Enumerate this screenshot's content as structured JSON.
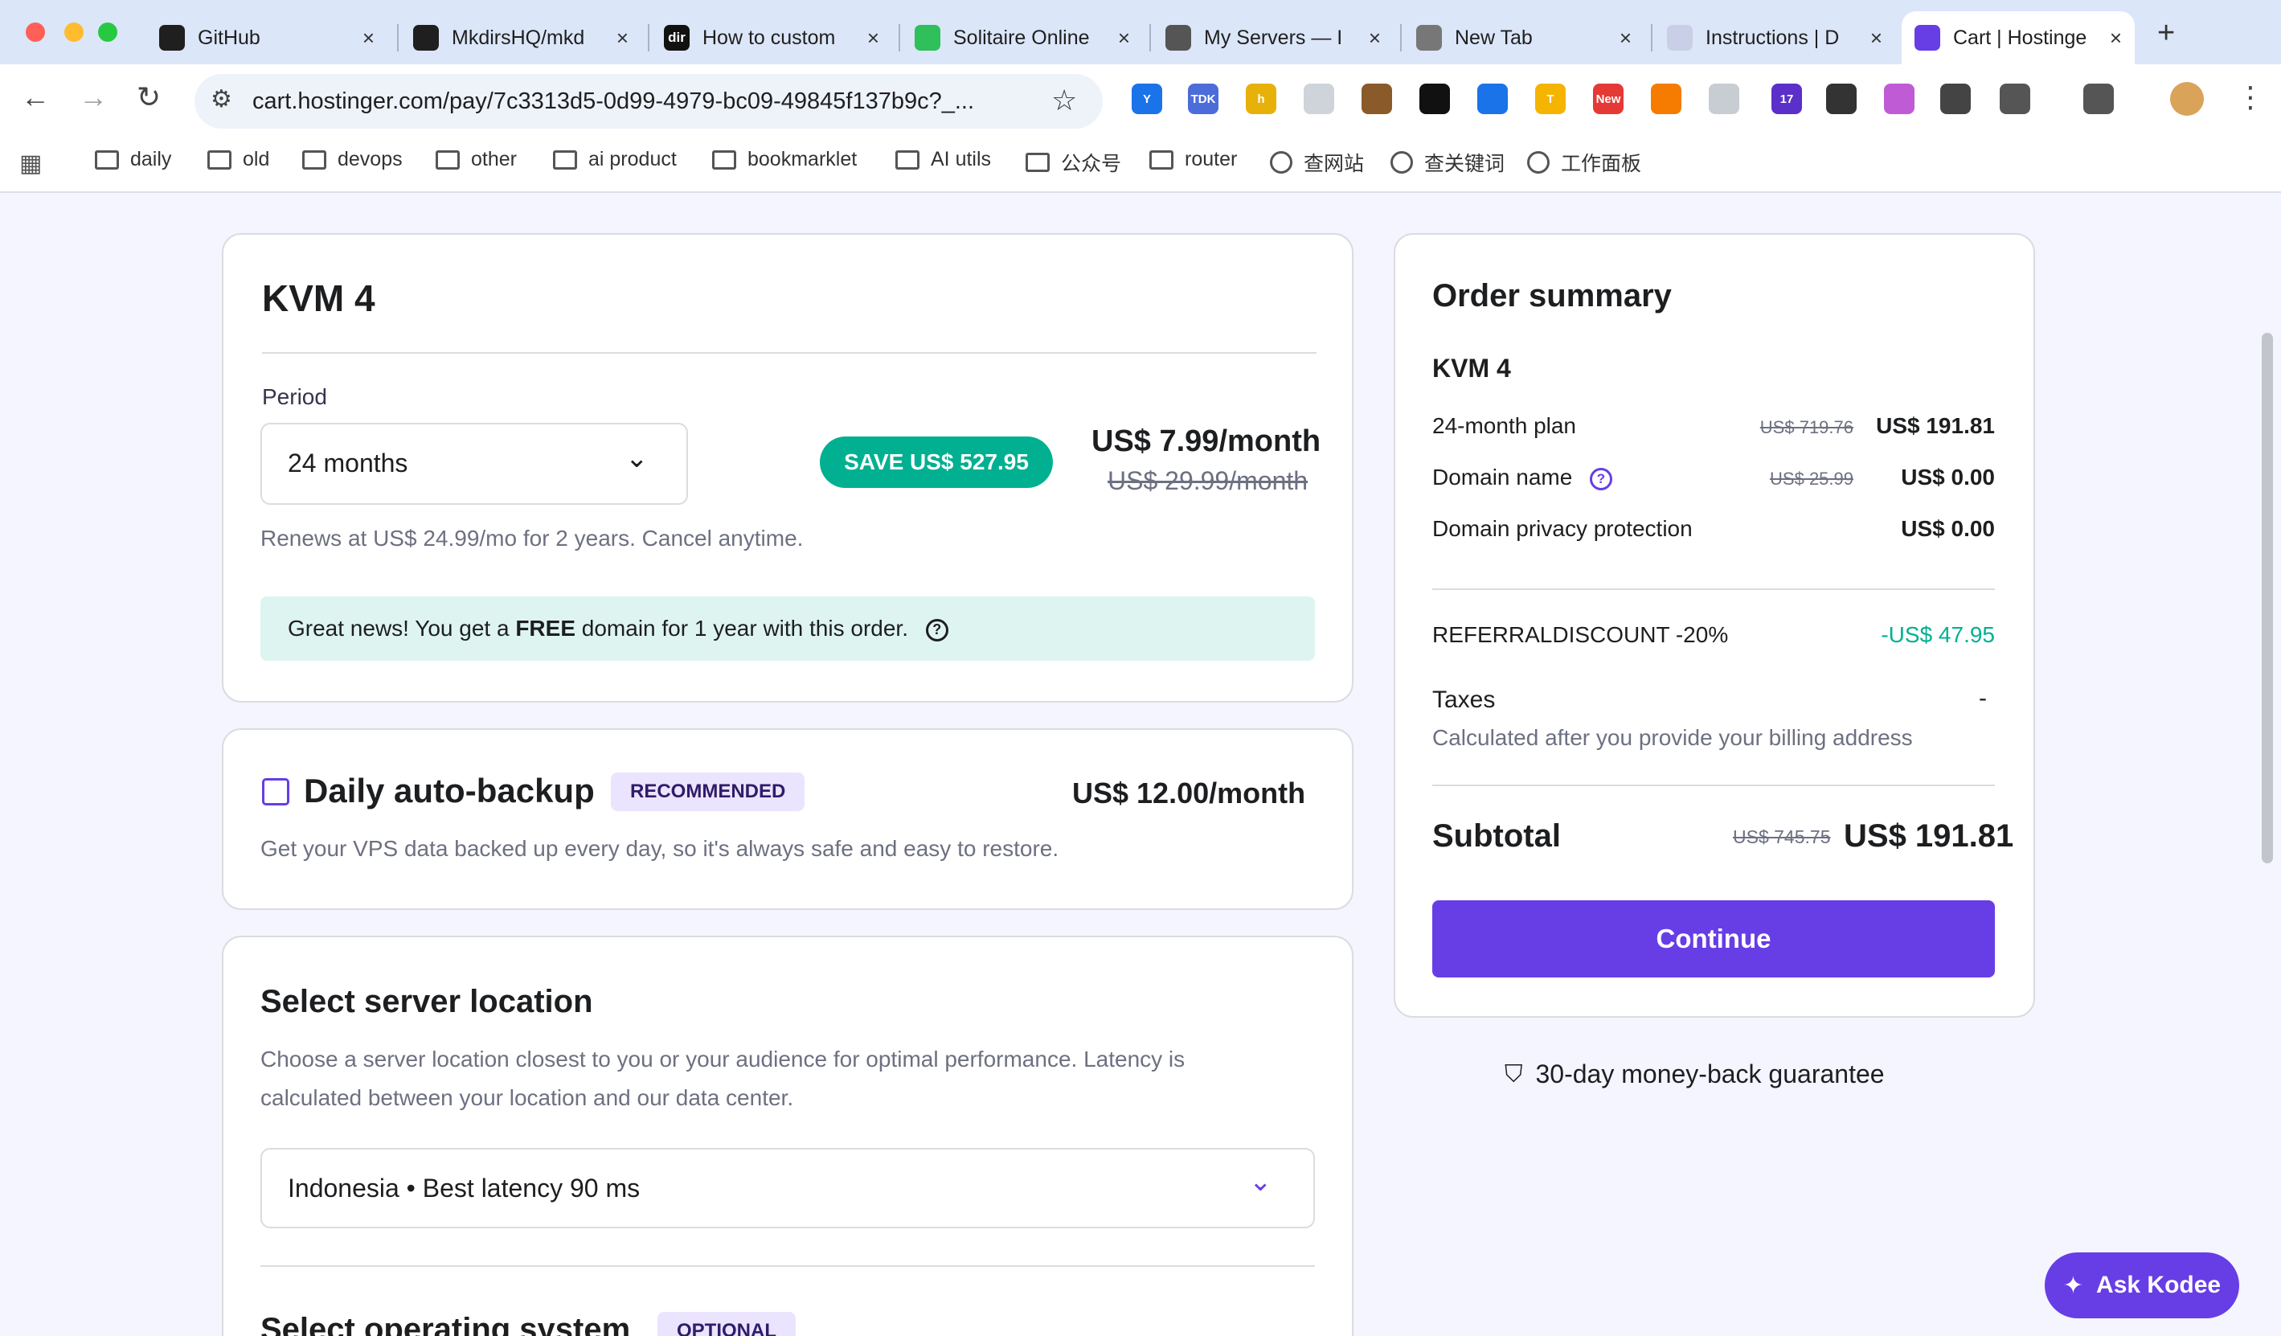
{
  "browser": {
    "tabs": [
      {
        "label": "GitHub",
        "icon": "github-icon",
        "color": "#1f1f1f"
      },
      {
        "label": "MkdirsHQ/mkd",
        "icon": "github-icon",
        "color": "#1f1f1f"
      },
      {
        "label": "How to custom",
        "icon": "dir-icon",
        "color": "#111111",
        "fav_text": "dir"
      },
      {
        "label": "Solitaire Online",
        "icon": "solitaire-icon",
        "color": "#2fbf5b"
      },
      {
        "label": "My Servers — I",
        "icon": "servers-icon",
        "color": "#555555"
      },
      {
        "label": "New Tab",
        "icon": "chrome-icon",
        "color": "#777777"
      },
      {
        "label": "Instructions | D",
        "icon": "instructions-icon",
        "color": "#c9cfe6"
      },
      {
        "label": "Cart | Hostinge",
        "icon": "hostinger-icon",
        "color": "#673de6"
      }
    ],
    "url": "cart.hostinger.com/pay/7c3313d5-0d99-4979-bc09-49845f137b9c?_...",
    "extensions": [
      {
        "name": "y-ext-icon",
        "text": "Y",
        "color": "#1a73e8"
      },
      {
        "name": "tdk-ext-icon",
        "text": "TDK",
        "color": "#4b6cd9"
      },
      {
        "name": "h-ext-icon",
        "text": "h",
        "color": "#e7b10a"
      },
      {
        "name": "page-ext-icon",
        "text": "",
        "color": "#cfd3da"
      },
      {
        "name": "cookie-ext-icon",
        "text": "",
        "color": "#8b5a2b"
      },
      {
        "name": "bear-ext-icon",
        "text": "",
        "color": "#111111"
      },
      {
        "name": "bolt-ext-icon",
        "text": "",
        "color": "#1a73e8"
      },
      {
        "name": "t-ext-icon",
        "text": "T",
        "color": "#f4b400"
      },
      {
        "name": "new-ext-icon",
        "text": "New",
        "color": "#e53935"
      },
      {
        "name": "fox-ext-icon",
        "text": "",
        "color": "#f57c00"
      },
      {
        "name": "cloud-ext-icon",
        "text": "",
        "color": "#c8ccd3"
      },
      {
        "name": "grad-ext-icon",
        "text": "17",
        "color": "#5b2fc9"
      },
      {
        "name": "dark-ext-icon",
        "text": "",
        "color": "#333333"
      },
      {
        "name": "brain-ext-icon",
        "text": "",
        "color": "#c05bd6"
      },
      {
        "name": "robot-ext-icon",
        "text": "",
        "color": "#444444"
      },
      {
        "name": "puzzle-ext-icon",
        "text": "",
        "color": "#555555"
      },
      {
        "name": "search-tab-ext-icon",
        "text": "",
        "color": "#555555"
      }
    ],
    "bookmarks": [
      {
        "label": "daily",
        "kind": "folder"
      },
      {
        "label": "old",
        "kind": "folder"
      },
      {
        "label": "devops",
        "kind": "folder"
      },
      {
        "label": "other",
        "kind": "folder"
      },
      {
        "label": "ai product",
        "kind": "folder"
      },
      {
        "label": "bookmarklet",
        "kind": "folder"
      },
      {
        "label": "AI utils",
        "kind": "folder"
      },
      {
        "label": "公众号",
        "kind": "folder"
      },
      {
        "label": "router",
        "kind": "folder"
      },
      {
        "label": "查网站",
        "kind": "globe"
      },
      {
        "label": "查关键词",
        "kind": "globe"
      },
      {
        "label": "工作面板",
        "kind": "globe"
      }
    ]
  },
  "plan": {
    "title": "KVM 4",
    "period_label": "Period",
    "period_value": "24 months",
    "save_badge": "SAVE US$ 527.95",
    "price": "US$ 7.99/month",
    "old_price": "US$ 29.99/month",
    "renew_text": "Renews at US$ 24.99/mo for 2 years. Cancel anytime.",
    "banner_pre": "Great news! You get a ",
    "banner_bold": "FREE",
    "banner_post": " domain for 1 year with this order."
  },
  "backup": {
    "title": "Daily auto-backup",
    "badge": "RECOMMENDED",
    "price": "US$ 12.00/month",
    "description": "Get your VPS data backed up every day, so it's always safe and easy to restore.",
    "checked": false
  },
  "location": {
    "title": "Select server location",
    "description_line1": "Choose a server location closest to you or your audience for optimal performance. Latency is",
    "description_line2": "calculated between your location and our data center.",
    "value": "Indonesia • Best latency 90 ms"
  },
  "os": {
    "title": "Select operating system",
    "badge": "OPTIONAL"
  },
  "summary": {
    "title": "Order summary",
    "product": "KVM 4",
    "lines": [
      {
        "label": "24-month plan",
        "old": "US$ 719.76",
        "value": "US$ 191.81"
      },
      {
        "label": "Domain name",
        "old": "US$ 25.99",
        "value": "US$ 0.00"
      },
      {
        "label": "Domain privacy protection",
        "old": "",
        "value": "US$ 0.00"
      }
    ],
    "discount_label": "REFERRALDISCOUNT -20%",
    "discount_value": "-US$ 47.95",
    "taxes_label": "Taxes",
    "taxes_value": "-",
    "taxes_note": "Calculated after you provide your billing address",
    "subtotal_label": "Subtotal",
    "subtotal_old": "US$ 745.75",
    "subtotal_value": "US$ 191.81",
    "continue_label": "Continue",
    "guarantee": "30-day money-back guarantee"
  },
  "assistant": {
    "label": "Ask Kodee"
  },
  "colors": {
    "brand": "#673de6",
    "save_green": "#00b090",
    "discount_green": "#00b090",
    "banner_bg": "#def4f0",
    "badge_bg": "#ebe4ff"
  }
}
